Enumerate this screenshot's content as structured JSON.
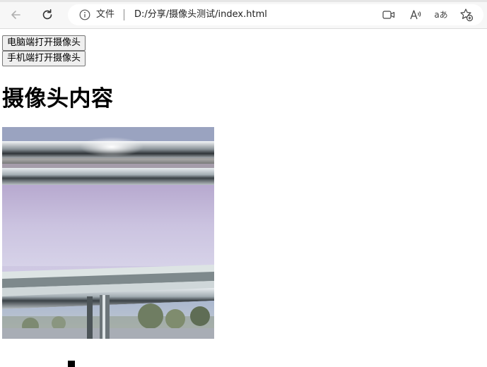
{
  "browser": {
    "address_bar": {
      "page_info_label": "文件",
      "url": "D:/分享/摄像头测试/index.html"
    },
    "icons": {
      "back": "back-arrow-icon",
      "refresh": "refresh-icon",
      "info": "info-icon",
      "camera": "video-camera-icon",
      "read_aloud": "read-aloud-icon",
      "translate": "translate-icon",
      "favorite": "add-favorite-icon"
    },
    "translate_label": "aあ"
  },
  "page": {
    "buttons": {
      "pc_camera": "电脑端打开摄像头",
      "mobile_camera": "手机端打开摄像头"
    },
    "camera_heading": "摄像头内容",
    "camera_view": {
      "content": "live camera feed showing a metal window railing, a pale purple wall and trees outside"
    }
  }
}
